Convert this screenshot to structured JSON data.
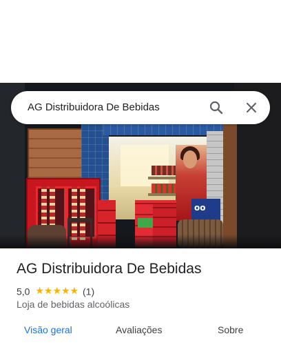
{
  "search": {
    "query": "AG Distribuidora De Bebidas",
    "icons": {
      "search": "search-icon",
      "close": "close-icon"
    }
  },
  "photo": {
    "subject": "storefront"
  },
  "place": {
    "name": "AG Distribuidora De Bebidas",
    "rating": "5,0",
    "stars": "★★★★★",
    "review_count": "(1)",
    "category": "Loja de bebidas alcoólicas"
  },
  "tabs": [
    {
      "label": "Visão geral",
      "active": true
    },
    {
      "label": "Avaliações",
      "active": false
    },
    {
      "label": "Sobre",
      "active": false
    }
  ],
  "colors": {
    "accent": "#1a73e8",
    "star": "#f8b400",
    "text": "#202124",
    "secondary": "#5f6368"
  }
}
